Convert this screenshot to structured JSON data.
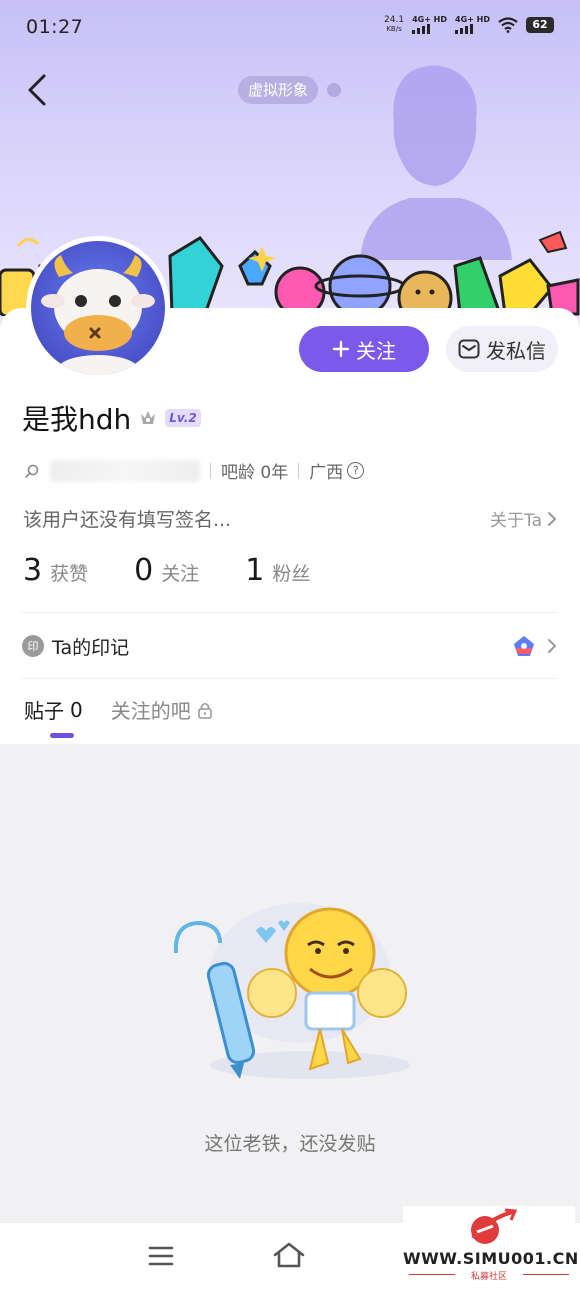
{
  "status_bar": {
    "time": "01:27",
    "net_speed_value": "24.1",
    "net_speed_unit": "KB/s",
    "sim1": "4G+ HD",
    "sim2": "4G+ HD",
    "battery": "62"
  },
  "header": {
    "virtual_avatar_tag": "虚拟形象"
  },
  "actions": {
    "follow_label": "关注",
    "message_label": "发私信"
  },
  "profile": {
    "username": "是我hdh",
    "level": "Lv.2",
    "bar_age": "吧龄 0年",
    "location": "广西",
    "help_symbol": "?",
    "signature": "该用户还没有填写签名...",
    "about_label": "关于Ta"
  },
  "stats": [
    {
      "value": "3",
      "label": "获赞"
    },
    {
      "value": "0",
      "label": "关注"
    },
    {
      "value": "1",
      "label": "粉丝"
    }
  ],
  "marks": {
    "icon_text": "印",
    "label": "Ta的印记"
  },
  "tabs": [
    {
      "label": "贴子",
      "count": "0"
    },
    {
      "label": "关注的吧"
    }
  ],
  "empty_state": {
    "message": "这位老铁，还没发贴"
  },
  "watermark": {
    "text": "WWW.SIMU001.CN",
    "subtitle": "私募社区"
  },
  "colors": {
    "accent": "#7b5ae9",
    "banner": "#d9d3fb",
    "empty_bg": "#f1f1f4"
  },
  "icons": [
    "back-arrow-icon",
    "plus-icon",
    "envelope-icon",
    "search-icon",
    "crown-icon",
    "chevron-right-icon",
    "lock-icon",
    "menu-icon",
    "home-icon"
  ]
}
